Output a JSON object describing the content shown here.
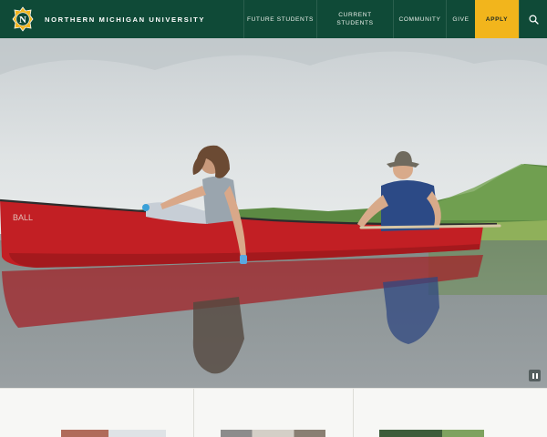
{
  "brand": {
    "name": "NORTHERN MICHIGAN UNIVERSITY",
    "logo_letter": "N"
  },
  "nav": {
    "future_students": "FUTURE STUDENTS",
    "current_students_line1": "CURRENT",
    "current_students_line2": "STUDENTS",
    "community": "COMMUNITY",
    "give": "GIVE",
    "apply": "APPLY"
  },
  "icons": {
    "search": "search-icon",
    "pause": "pause-icon",
    "logo": "nmu-logo-icon"
  },
  "colors": {
    "header_bg": "#0f4a37",
    "apply_bg": "#f2b51c",
    "canoe_red": "#c21f24",
    "water": "#8c9495"
  },
  "hero": {
    "media": "canoe-on-lake-photo",
    "video_state": "playing"
  }
}
